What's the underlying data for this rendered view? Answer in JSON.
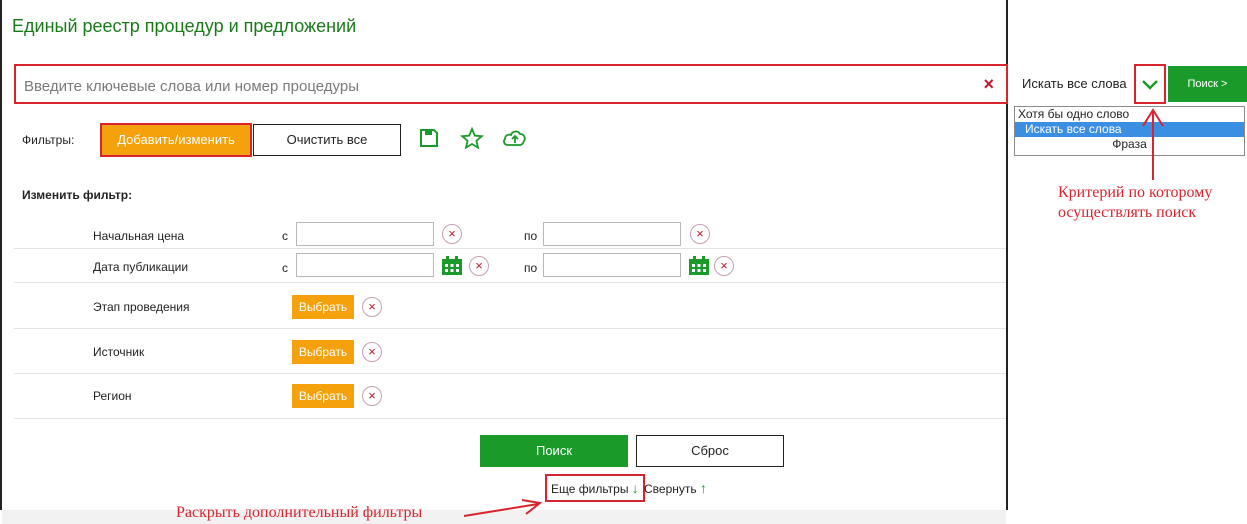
{
  "page": {
    "title": "Единый реестр процедур и предложений"
  },
  "search": {
    "placeholder": "Введите ключевые слова или номер процедуры",
    "value": "",
    "clear_icon": "×",
    "mode_selected": "Искать все слова",
    "go_label": "Поиск >",
    "mode_options": [
      "Хотя бы одно слово",
      "Искать все слова",
      "Фраза"
    ]
  },
  "filters_bar": {
    "label": "Фильтры:",
    "add_label": "Добавить/изменить",
    "clear_label": "Очистить все",
    "icons": [
      "save-icon",
      "star-icon",
      "cloud-upload-icon"
    ]
  },
  "edit_filter": {
    "heading": "Изменить фильтр:",
    "from_label": "с",
    "to_label": "по",
    "choose_label": "Выбрать",
    "remove_icon": "×",
    "rows": [
      {
        "label": "Начальная цена"
      },
      {
        "label": "Дата публикации"
      },
      {
        "label": "Этап проведения"
      },
      {
        "label": "Источник"
      },
      {
        "label": "Регион"
      }
    ]
  },
  "actions": {
    "search_label": "Поиск",
    "reset_label": "Сброс",
    "more_filters_label": "Еще фильтры",
    "collapse_label": "Свернуть",
    "down_arrow": "↓",
    "up_arrow": "↑"
  },
  "annotations": {
    "criterion_line1": "Критерий по которому",
    "criterion_line2": "осуществлять поиск",
    "expand_filters": "Раскрыть дополнительный фильтры"
  },
  "colors": {
    "accent_green": "#1a9a28",
    "title_green": "#1a7a1a",
    "orange": "#f5a10b",
    "highlight_red": "#d9232e",
    "selection_blue": "#3b8fe3"
  }
}
